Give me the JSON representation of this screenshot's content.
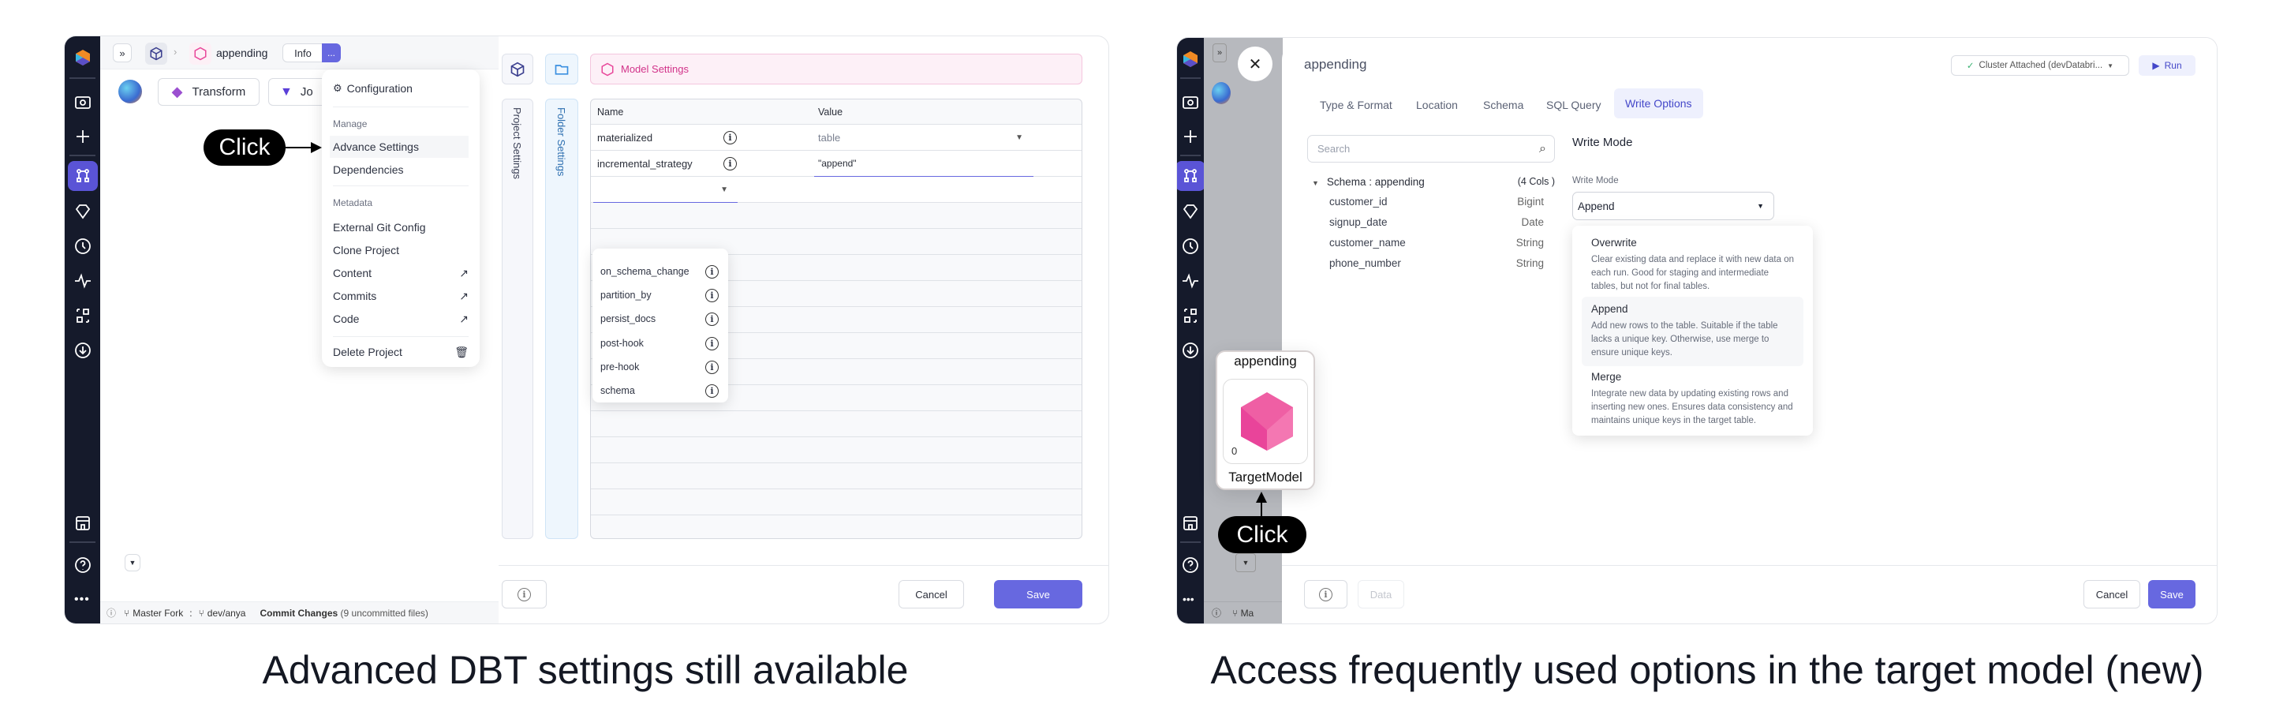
{
  "captions": {
    "left": "Advanced DBT settings still available",
    "right": "Access frequently used options in the target model (new)"
  },
  "left": {
    "topbar": {
      "project": "appending",
      "info_label": "Info",
      "more_label": "..."
    },
    "toolbar": {
      "transform_label": "Transform",
      "join_label": "Jo"
    },
    "menu": {
      "configuration": "Configuration",
      "manage_heading": "Manage",
      "manage_items": [
        "Advance Settings",
        "Dependencies"
      ],
      "metadata_heading": "Metadata",
      "metadata_items": [
        {
          "label": "External Git Config",
          "external": false
        },
        {
          "label": "Clone Project",
          "external": false
        },
        {
          "label": "Content",
          "external": true
        },
        {
          "label": "Commits",
          "external": true
        },
        {
          "label": "Code",
          "external": true
        }
      ],
      "delete": "Delete Project"
    },
    "click_label": "Click",
    "statusbar": {
      "branch_main": "Master Fork",
      "separator": ":",
      "branch_dev": "dev/anya",
      "commit_label": "Commit Changes",
      "commit_count": "(9 uncommitted files)"
    },
    "settings": {
      "banner": "Model Settings",
      "vtab_project": "Project Settings",
      "vtab_folder": "Folder Settings",
      "columns": [
        "Name",
        "Value"
      ],
      "rows": [
        {
          "name": "materialized",
          "value": "table"
        },
        {
          "name": "incremental_strategy",
          "value": "\"append\""
        }
      ],
      "dropdown_options": [
        "on_schema_change",
        "partition_by",
        "persist_docs",
        "post-hook",
        "pre-hook",
        "schema"
      ],
      "cancel": "Cancel",
      "save": "Save"
    }
  },
  "right": {
    "title": "appending",
    "cluster": "Cluster Attached (devDatabri...",
    "run": "Run",
    "tabs": [
      "Type & Format",
      "Location",
      "Schema",
      "SQL Query",
      "Write Options"
    ],
    "active_tab": "Write Options",
    "search_placeholder": "Search",
    "schema": {
      "title": "Schema : appending",
      "count": "(4 Cols )",
      "columns": [
        {
          "name": "customer_id",
          "type": "Bigint"
        },
        {
          "name": "signup_date",
          "type": "Date"
        },
        {
          "name": "customer_name",
          "type": "String"
        },
        {
          "name": "phone_number",
          "type": "String"
        }
      ]
    },
    "write_mode": {
      "heading": "Write Mode",
      "label": "Write Mode",
      "selected": "Append",
      "options": [
        {
          "title": "Overwrite",
          "desc": "Clear existing data and replace it with new data on each run. Good for staging and intermediate tables, but not for final tables."
        },
        {
          "title": "Append",
          "desc": "Add new rows to the table. Suitable if the table lacks a unique key. Otherwise, use merge to ensure unique keys."
        },
        {
          "title": "Merge",
          "desc": "Integrate new data by updating existing rows and inserting new ones. Ensures data consistency and maintains unique keys in the target table."
        }
      ]
    },
    "node": {
      "title": "appending",
      "count": "0",
      "label": "TargetModel"
    },
    "click_label": "Click",
    "data_label": "Data",
    "cancel": "Cancel",
    "save": "Save",
    "status_partial": "Ma"
  },
  "colors": {
    "accent": "#6768e0",
    "sidebar": "#151a2b",
    "model_pink": "#e8479a"
  }
}
